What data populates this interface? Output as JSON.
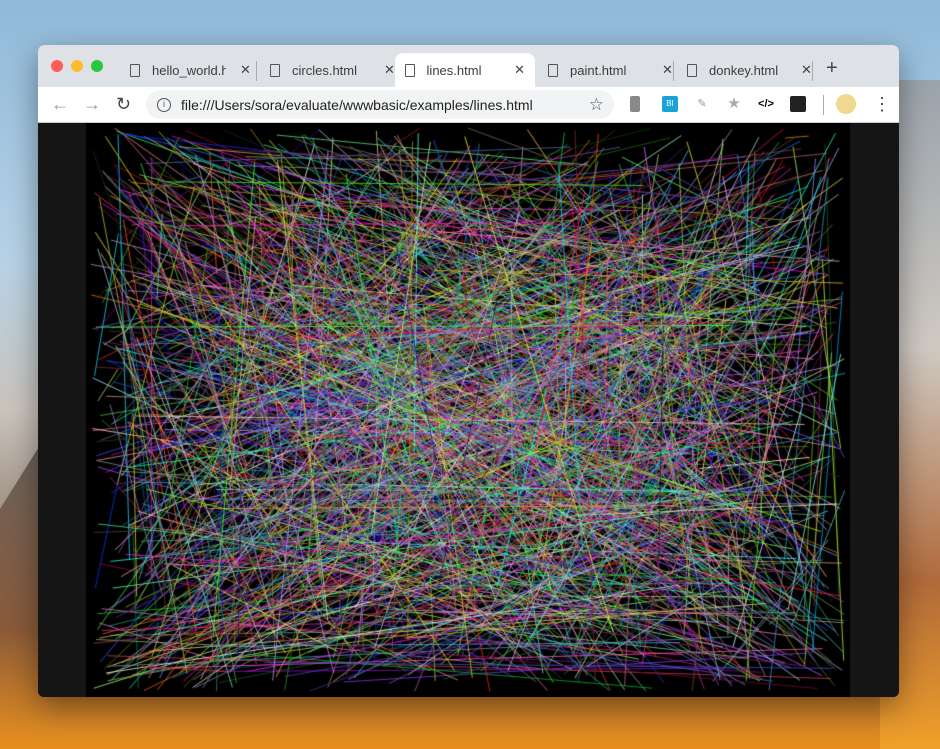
{
  "tabs": [
    {
      "label": "hello_world.html",
      "active": false
    },
    {
      "label": "circles.html",
      "active": false
    },
    {
      "label": "lines.html",
      "active": true
    },
    {
      "label": "paint.html",
      "active": false
    },
    {
      "label": "donkey.html",
      "active": false
    }
  ],
  "new_tab": "+",
  "address": "file:///Users/sora/evaluate/wwwbasic/examples/lines.html",
  "colors": {
    "close": "#fd5f57",
    "minimize": "#fdbc2e",
    "maximize": "#28c840",
    "canvas": "#000000"
  }
}
